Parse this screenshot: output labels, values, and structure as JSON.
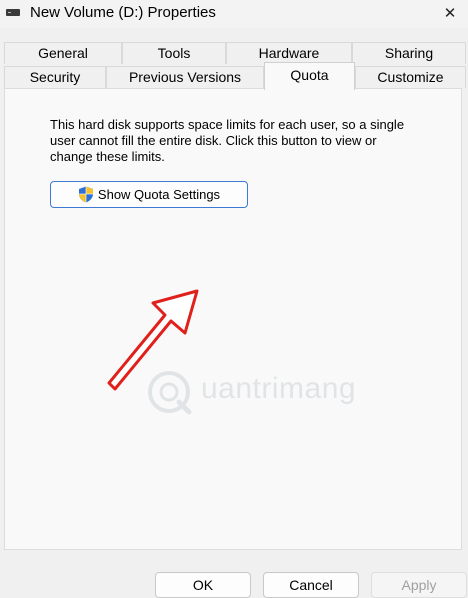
{
  "window": {
    "title": "New Volume (D:) Properties",
    "close_glyph": "✕"
  },
  "tabs": {
    "row1": [
      "General",
      "Tools",
      "Hardware",
      "Sharing"
    ],
    "row2": [
      "Security",
      "Previous Versions",
      "Quota",
      "Customize"
    ],
    "active": "Quota"
  },
  "quota": {
    "description": "This hard disk supports space limits for each user, so a single user cannot fill the entire disk. Click this button to view or change these limits.",
    "button_label": "Show Quota Settings"
  },
  "watermark": {
    "text": "uantrimang"
  },
  "buttons": {
    "ok": "OK",
    "cancel": "Cancel",
    "apply": "Apply"
  },
  "colors": {
    "accent": "#3c7bd1",
    "arrow": "#e0201b",
    "shield_blue": "#2f6fd8",
    "shield_yellow": "#f6c12e"
  }
}
